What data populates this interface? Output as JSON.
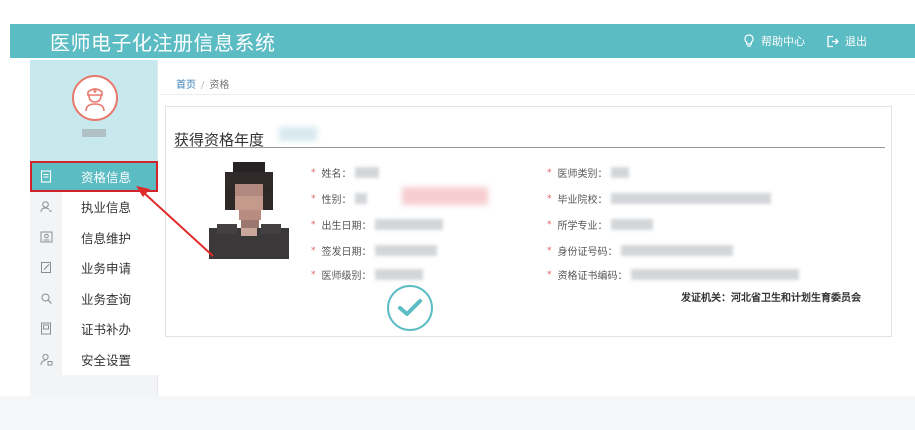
{
  "header": {
    "app_title": "医师电子化注册信息系统",
    "help_label": "帮助中心",
    "logout_label": "退出",
    "bg_color": "#5bbcc4"
  },
  "sidebar": {
    "avatar_icon": "doctor-icon",
    "items": [
      {
        "label": "资格信息",
        "icon": "document-icon",
        "active": true
      },
      {
        "label": "执业信息",
        "icon": "user-search-icon",
        "active": false
      },
      {
        "label": "信息维护",
        "icon": "id-card-icon",
        "active": false
      },
      {
        "label": "业务申请",
        "icon": "edit-doc-icon",
        "active": false
      },
      {
        "label": "业务查询",
        "icon": "query-icon",
        "active": false
      },
      {
        "label": "证书补办",
        "icon": "certificate-icon",
        "active": false
      },
      {
        "label": "安全设置",
        "icon": "user-lock-icon",
        "active": false
      }
    ]
  },
  "breadcrumb": {
    "home": "首页",
    "separator": "/",
    "current": "资格"
  },
  "qualification": {
    "title": "获得资格年度",
    "left_fields": [
      {
        "label": "姓名："
      },
      {
        "label": "性别："
      },
      {
        "label": "出生日期："
      },
      {
        "label": "签发日期："
      },
      {
        "label": "医师级别："
      }
    ],
    "right_fields": [
      {
        "label": "医师类别："
      },
      {
        "label": "毕业院校："
      },
      {
        "label": "所学专业："
      },
      {
        "label": "身份证号码："
      },
      {
        "label": "资格证书编码："
      }
    ],
    "issuer_label": "发证机关：",
    "issuer_value": "河北省卫生和计划生育委员会"
  },
  "colors": {
    "accent": "#5bbcc4",
    "annotation": "#d0232a",
    "required_star": "#e25d5d"
  }
}
